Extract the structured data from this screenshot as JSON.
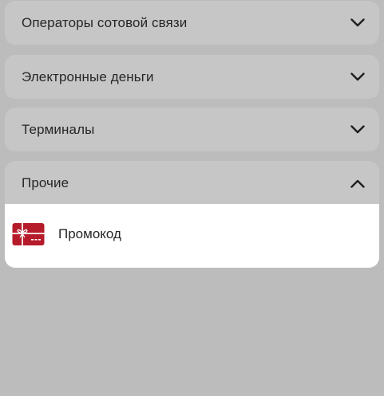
{
  "sections": [
    {
      "title": "Операторы сотовой связи",
      "state": "collapsed",
      "icon": "chevron-down-icon"
    },
    {
      "title": "Электронные деньги",
      "state": "collapsed",
      "icon": "chevron-down-icon"
    },
    {
      "title": "Терминалы",
      "state": "collapsed",
      "icon": "chevron-down-icon"
    },
    {
      "title": "Прочие",
      "state": "expanded",
      "icon": "chevron-up-icon"
    }
  ],
  "other_items": [
    {
      "label": "Промокод",
      "icon": "gift-card-icon"
    }
  ],
  "colors": {
    "background": "#bcbcbc",
    "section_background": "#c6c6c6",
    "panel_background": "#ffffff",
    "gift_card": "#b51b2b",
    "text": "#262626"
  }
}
